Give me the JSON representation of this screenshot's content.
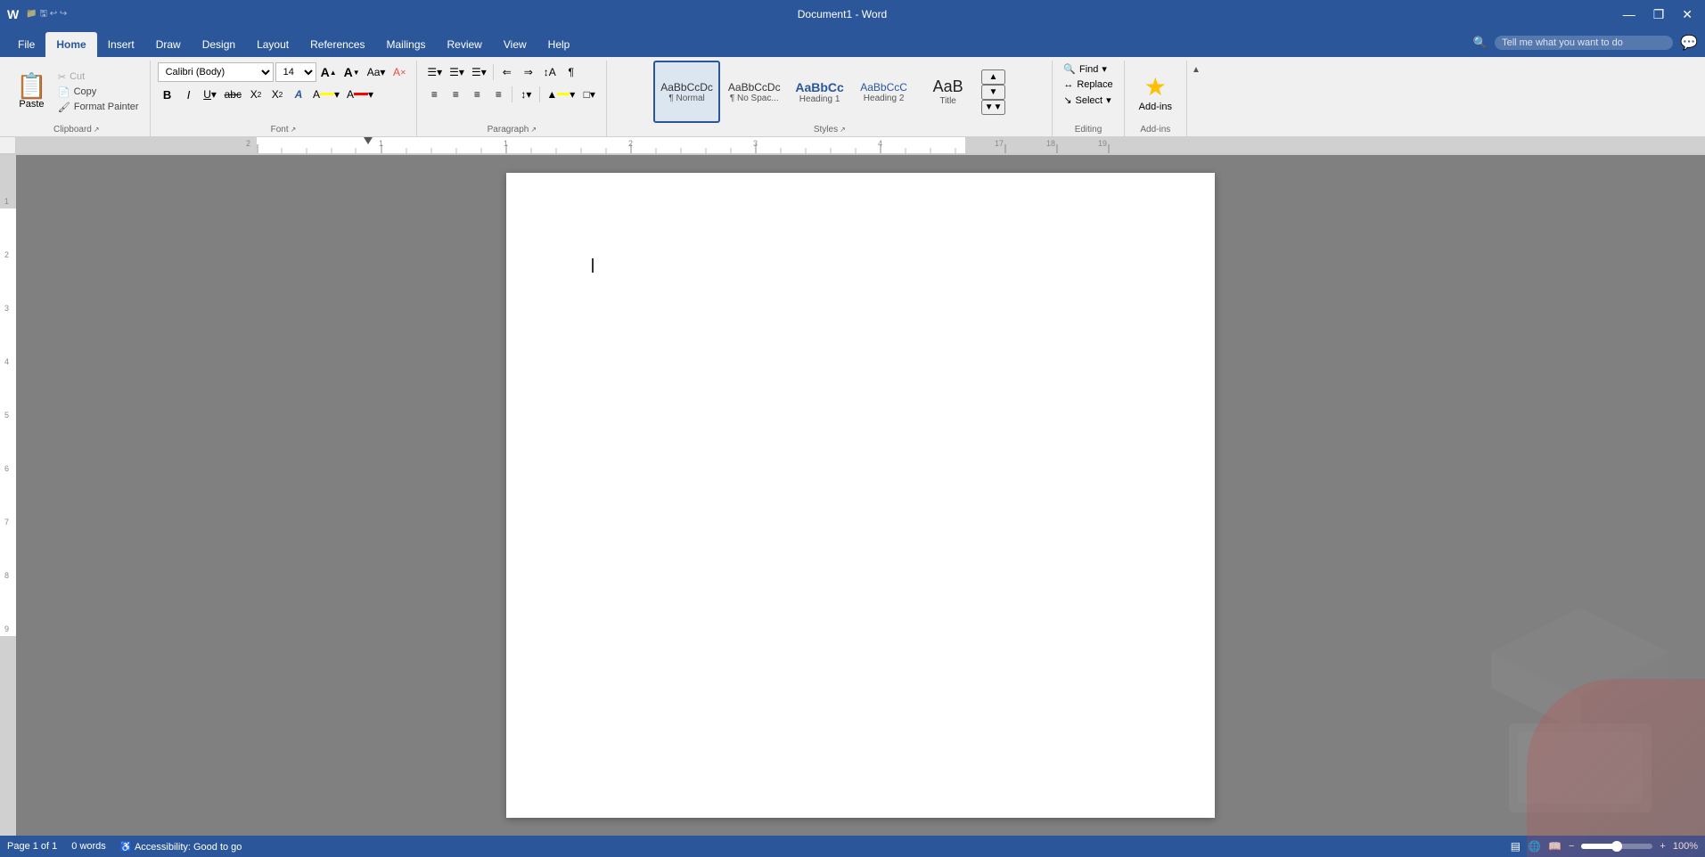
{
  "titleBar": {
    "title": "Document1 - Word",
    "minimize": "—",
    "restore": "❐",
    "close": "✕"
  },
  "ribbonTabs": {
    "tabs": [
      {
        "id": "file",
        "label": "File",
        "active": false
      },
      {
        "id": "home",
        "label": "Home",
        "active": true
      },
      {
        "id": "insert",
        "label": "Insert",
        "active": false
      },
      {
        "id": "draw",
        "label": "Draw",
        "active": false
      },
      {
        "id": "design",
        "label": "Design",
        "active": false
      },
      {
        "id": "layout",
        "label": "Layout",
        "active": false
      },
      {
        "id": "references",
        "label": "References",
        "active": false
      },
      {
        "id": "mailings",
        "label": "Mailings",
        "active": false
      },
      {
        "id": "review",
        "label": "Review",
        "active": false
      },
      {
        "id": "view",
        "label": "View",
        "active": false
      },
      {
        "id": "help",
        "label": "Help",
        "active": false
      }
    ]
  },
  "searchBar": {
    "placeholder": "Tell me what you want to do",
    "icon": "🔍"
  },
  "ribbon": {
    "clipboard": {
      "groupLabel": "Clipboard",
      "paste": {
        "label": "Paste",
        "icon": "📋"
      },
      "cut": {
        "label": "Cut",
        "icon": "✂",
        "disabled": true
      },
      "copy": {
        "label": "Copy",
        "icon": "📄",
        "disabled": false
      },
      "formatPainter": {
        "label": "Format Painter",
        "icon": "🖌"
      }
    },
    "font": {
      "groupLabel": "Font",
      "fontName": "Calibri (Body)",
      "fontSize": "14",
      "growBtn": "A",
      "shrinkBtn": "A",
      "caseBtn": "Aa",
      "clearBtn": "A",
      "bold": "B",
      "italic": "I",
      "underline": "U",
      "strikethrough": "abc",
      "subscript": "X₂",
      "superscript": "X²",
      "textEffects": "A",
      "textHighlight": "A",
      "fontColor": "A"
    },
    "paragraph": {
      "groupLabel": "Paragraph",
      "bullets": "≡",
      "numbering": "≡",
      "multilevel": "≡",
      "decreaseIndent": "⇐",
      "increaseIndent": "⇒",
      "sort": "↕",
      "showHide": "¶",
      "alignLeft": "≡",
      "alignCenter": "≡",
      "alignRight": "≡",
      "justify": "≡",
      "lineSpacing": "↕",
      "shading": "▲",
      "borders": "□"
    },
    "styles": {
      "groupLabel": "Styles",
      "items": [
        {
          "id": "normal",
          "label": "¶ Normal",
          "preview": "AaBbCcDc",
          "active": true
        },
        {
          "id": "no-space",
          "label": "¶ No Spac...",
          "preview": "AaBbCcDc",
          "active": false
        },
        {
          "id": "heading1",
          "label": "Heading 1",
          "preview": "AaBbCc",
          "active": false
        },
        {
          "id": "heading2",
          "label": "Heading 2",
          "preview": "AaBbCcC",
          "active": false
        },
        {
          "id": "title",
          "label": "Title",
          "preview": "AaB",
          "active": false
        }
      ]
    },
    "editing": {
      "groupLabel": "Editing",
      "find": {
        "label": "Find",
        "icon": "🔍",
        "hasArrow": true
      },
      "replace": {
        "label": "Replace",
        "icon": "↔"
      },
      "select": {
        "label": "Select",
        "icon": "↘",
        "hasArrow": true
      }
    },
    "addins": {
      "groupLabel": "Add-ins",
      "label": "Add-ins",
      "icon": "★"
    }
  },
  "statusBar": {
    "page": "Page 1 of 1",
    "words": "0 words",
    "accessibility": "Accessibility: Good to go",
    "zoom": "100%"
  }
}
